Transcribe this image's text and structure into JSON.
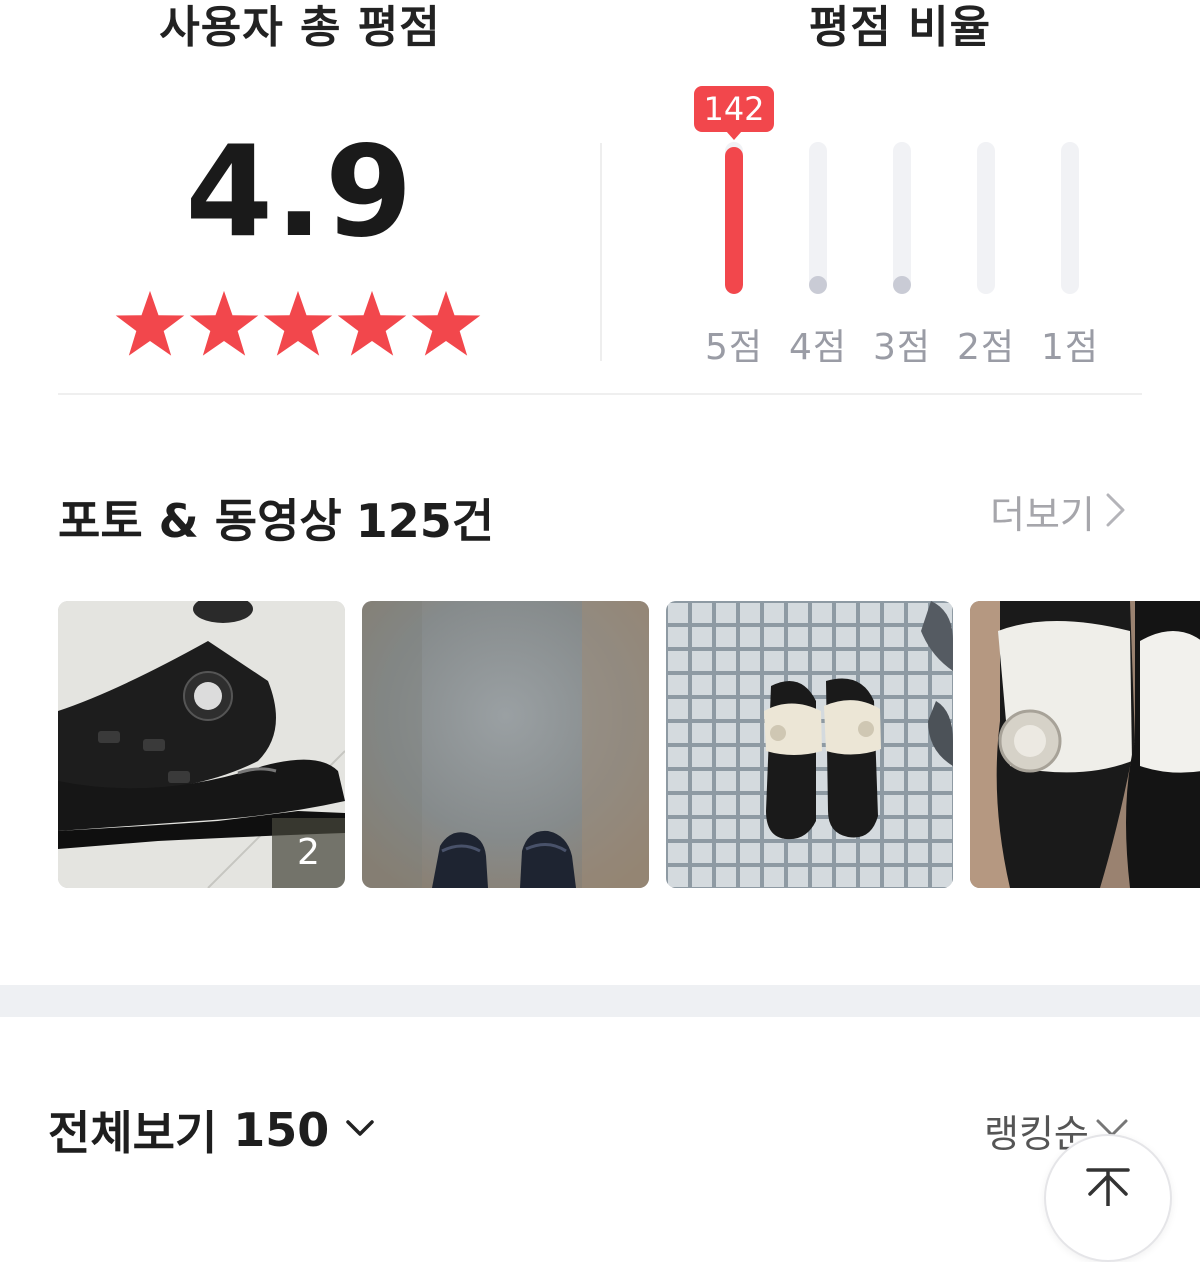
{
  "summary": {
    "avg_title": "사용자 총 평점",
    "avg_score": "4.9",
    "stars": 5,
    "star_color": "#f2474c",
    "ratio_title": "평점 비율",
    "highlight_count": "142",
    "ratio_bars": [
      {
        "label": "5점",
        "fraction": 0.97,
        "color": "#f2474c"
      },
      {
        "label": "4점",
        "fraction": 0.12,
        "color": "#c9cbd5"
      },
      {
        "label": "3점",
        "fraction": 0.12,
        "color": "#c9cbd5"
      },
      {
        "label": "2점",
        "fraction": 0.0,
        "color": "#c9cbd5"
      },
      {
        "label": "1점",
        "fraction": 0.0,
        "color": "#c9cbd5"
      }
    ]
  },
  "photos": {
    "title": "포토 & 동영상",
    "count": "125건",
    "more_label": "더보기",
    "first_thumb_count": "2"
  },
  "reviews": {
    "filter_label": "전체보기",
    "filter_count": "150",
    "sort_label": "랭킹순"
  },
  "icons": {
    "star": "star-icon",
    "more": "chevron-right-icon",
    "filter": "chevron-down-icon",
    "sort": "chevron-down-icon",
    "top": "arrow-up-icon"
  },
  "colors": {
    "accent": "#f2474c",
    "muted_text": "#9a9ca5",
    "track": "#f1f2f5",
    "section_gap": "#eef0f3"
  }
}
